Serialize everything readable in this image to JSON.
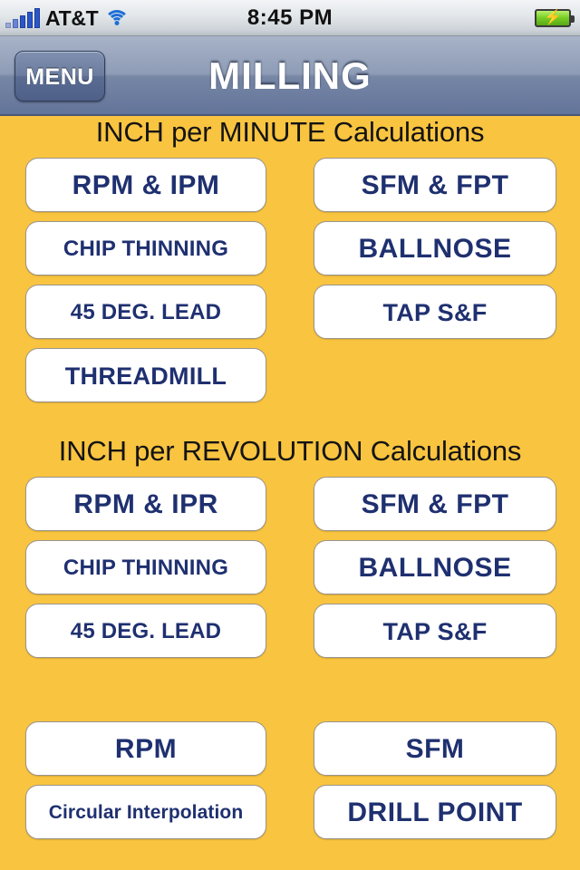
{
  "status_bar": {
    "signal_bars": 5,
    "carrier": "AT&T",
    "wifi_icon": "wifi-icon",
    "time": "8:45 PM",
    "battery_icon": "battery-charging-icon",
    "battery_bolt": "⚡"
  },
  "nav_bar": {
    "menu_label": "MENU",
    "title": "MILLING"
  },
  "sections": [
    {
      "header": "INCH per MINUTE Calculations",
      "buttons": [
        {
          "label": "RPM  &  IPM",
          "column": "left",
          "size": "lg"
        },
        {
          "label": "SFM  &  FPT",
          "column": "right",
          "size": "lg"
        },
        {
          "label": "CHIP THINNING",
          "column": "left",
          "size": "sm"
        },
        {
          "label": "BALLNOSE",
          "column": "right",
          "size": "lg"
        },
        {
          "label": "45 DEG. LEAD",
          "column": "left",
          "size": "sm"
        },
        {
          "label": "TAP S&F",
          "column": "right",
          "size": "md"
        },
        {
          "label": "THREADMILL",
          "column": "left",
          "size": "md"
        }
      ]
    },
    {
      "header": "INCH per REVOLUTION Calculations",
      "buttons": [
        {
          "label": "RPM  &  IPR",
          "column": "left",
          "size": "lg"
        },
        {
          "label": "SFM  &  FPT",
          "column": "right",
          "size": "lg"
        },
        {
          "label": "CHIP THINNING",
          "column": "left",
          "size": "sm"
        },
        {
          "label": "BALLNOSE",
          "column": "right",
          "size": "lg"
        },
        {
          "label": "45 DEG. LEAD",
          "column": "left",
          "size": "sm"
        },
        {
          "label": "TAP S&F",
          "column": "right",
          "size": "md"
        }
      ]
    },
    {
      "header": "",
      "buttons": [
        {
          "label": "RPM",
          "column": "left",
          "size": "lg"
        },
        {
          "label": "SFM",
          "column": "right",
          "size": "lg"
        },
        {
          "label": "Circular Interpolation",
          "column": "left",
          "size": "xs"
        },
        {
          "label": "DRILL POINT",
          "column": "right",
          "size": "lg"
        }
      ]
    }
  ],
  "colors": {
    "background": "#F9C440",
    "button_text": "#1F3070",
    "navbar_top": "#a7b3c8",
    "navbar_bottom": "#63749a",
    "battery_green": "#76cc25",
    "signal_blue": "#2a56c8"
  }
}
